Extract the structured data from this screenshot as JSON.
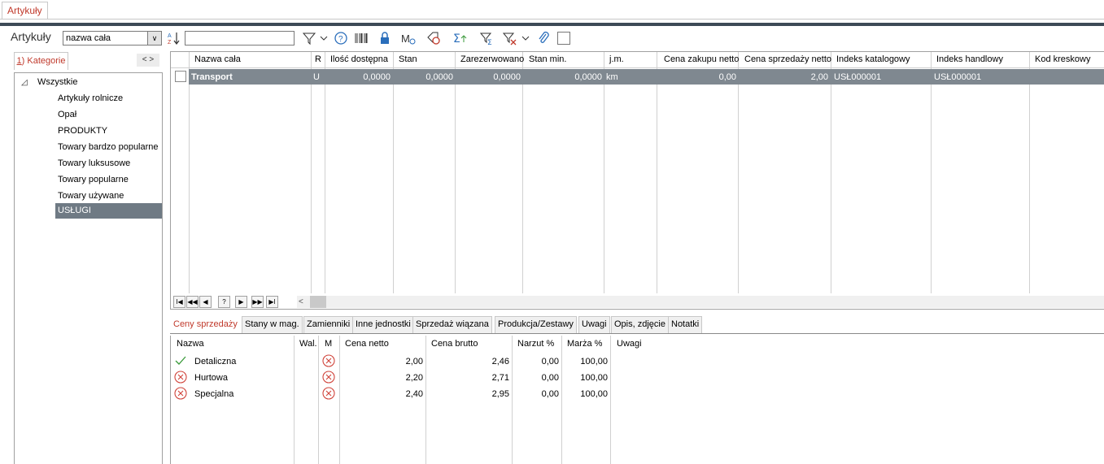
{
  "window_tab": "Artykuły",
  "panel": {
    "title": "Artykuły",
    "search_mode": "nazwa cała",
    "search_value": ""
  },
  "toolbar_icons": [
    "sort-az-icon",
    "filter-icon",
    "chevron-down-icon",
    "help-icon",
    "barcode-icon",
    "lock-icon",
    "symbol-m-icon",
    "tag-clock-icon",
    "sum-icon",
    "filter-sum-icon",
    "filter-clear-icon",
    "chevron-down-icon",
    "paperclip-icon",
    "checkbox-icon"
  ],
  "categories": {
    "tab_label_prefix": "1",
    "tab_label": ") Kategorie",
    "nav": "< >",
    "root": "Wszystkie",
    "items": [
      "Artykuły rolnicze",
      "Opał",
      "PRODUKTY",
      "Towary bardzo popularne",
      "Towary luksusowe",
      "Towary popularne",
      "Towary używane",
      "USŁUGI"
    ],
    "selected": "USŁUGI"
  },
  "grid": {
    "columns": [
      "Nazwa cała",
      "R",
      "Ilość dostępna",
      "Stan",
      "Zarezerwowano",
      "Stan min.",
      "j.m.",
      "Cena zakupu netto",
      "Cena sprzedaży netto",
      "Indeks katalogowy",
      "Indeks handlowy",
      "Kod kreskowy"
    ],
    "rows": [
      {
        "name": "Transport",
        "r": "U",
        "ilosc": "0,0000",
        "stan": "0,0000",
        "zarezerwowano": "0,0000",
        "stan_min": "0,0000",
        "jm": "km",
        "cena_zakupu": "0,00",
        "cena_sprzedazy": "2,00",
        "indeks_katalogowy": "USŁ000001",
        "indeks_handlowy": "USŁ000001",
        "kod": ""
      }
    ],
    "nav_buttons": [
      "I◀",
      "◀◀",
      "◀",
      "?",
      "▶",
      "▶▶",
      "▶I"
    ],
    "scroll_arrow": "<"
  },
  "bottom_tabs": [
    "Ceny sprzedaży",
    "Stany w mag.",
    "Zamienniki",
    "Inne jednostki",
    "Sprzedaż wiązana",
    "Produkcja/Zestawy",
    "Uwagi",
    "Opis, zdjęcie",
    "Notatki"
  ],
  "prices": {
    "columns": [
      "Nazwa",
      "Wal.",
      "M",
      "Cena netto",
      "Cena brutto",
      "Narzut %",
      "Marża %",
      "Uwagi"
    ],
    "rows": [
      {
        "icon": "check-icon",
        "nazwa": "Detaliczna",
        "m_icon": "x-circle-icon",
        "netto": "2,00",
        "brutto": "2,46",
        "narzut": "0,00",
        "marza": "100,00",
        "uwagi": ""
      },
      {
        "icon": "x-circle-icon",
        "nazwa": "Hurtowa",
        "m_icon": "x-circle-icon",
        "netto": "2,20",
        "brutto": "2,71",
        "narzut": "0,00",
        "marza": "100,00",
        "uwagi": ""
      },
      {
        "icon": "x-circle-icon",
        "nazwa": "Specjalna",
        "m_icon": "x-circle-icon",
        "netto": "2,40",
        "brutto": "2,95",
        "narzut": "0,00",
        "marza": "100,00",
        "uwagi": ""
      }
    ]
  },
  "colors": {
    "accent": "#c0392b",
    "selected_row": "#7f8890",
    "selected_tree": "#6f7a84",
    "dark_band": "#3d4a57"
  }
}
